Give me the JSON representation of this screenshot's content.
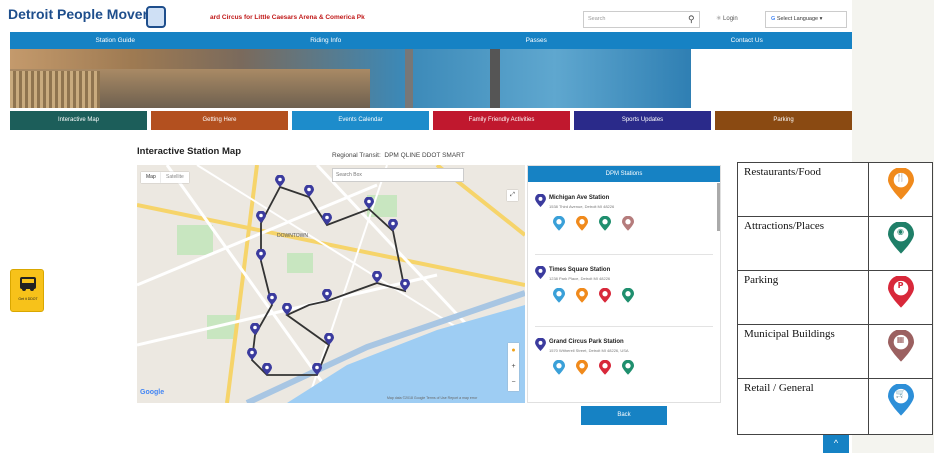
{
  "header": {
    "logo": "Detroit People Mover",
    "ticker": "ard Circus for Little Caesars Arena & Comerica Pk",
    "search_placeholder": "Search",
    "login": "Login",
    "language": "Select Language"
  },
  "nav": [
    "Station Guide",
    "Riding Info",
    "Passes",
    "Contact Us"
  ],
  "categories": [
    {
      "label": "Interactive Map",
      "color": "#1c5e5a"
    },
    {
      "label": "Getting Here",
      "color": "#b3501f"
    },
    {
      "label": "Events Calendar",
      "color": "#1d8ccb"
    },
    {
      "label": "Family Friendly Activities",
      "color": "#c0182e"
    },
    {
      "label": "Sports Updates",
      "color": "#2a2a8a"
    },
    {
      "label": "Parking",
      "color": "#8a4a12"
    }
  ],
  "section": {
    "title": "Interactive Station Map",
    "regional": "Regional Transit:",
    "transit_options": "DPM  QLINE  DDOT  SMART"
  },
  "map": {
    "view_map": "Map",
    "view_satellite": "Satellite",
    "search_placeholder": "Search Box",
    "downtown_label": "DOWNTOWN",
    "google": "Google",
    "footer": "Map data ©2018 Google   Terms of Use   Report a map error"
  },
  "panel": {
    "title": "DPM Stations",
    "stations": [
      {
        "name": "Michigan Ave Station",
        "address": "1538 Third Avenue, Detroit MI 48226",
        "icons": [
          "#3aa0d8",
          "#f08a1c",
          "#1f8f6e",
          "#b57c7c"
        ]
      },
      {
        "name": "Times Square Station",
        "address": "1238 Park Place, Detroit MI 48226",
        "icons": [
          "#3aa0d8",
          "#f08a1c",
          "#d8283a",
          "#1f8f6e"
        ]
      },
      {
        "name": "Grand Circus Park Station",
        "address": "1570 Witherell Street, Detroit MI 48226, USA",
        "icons": [
          "#3aa0d8",
          "#f08a1c",
          "#d8283a",
          "#1f8f6e"
        ]
      }
    ]
  },
  "back_button": "Back",
  "app_badge": "Get it DDOT",
  "legend": [
    {
      "label": "Restaurants/Food",
      "color": "#f08a1c",
      "icon": "food-icon",
      "glyph": "🍴"
    },
    {
      "label": "Attractions/Places",
      "color": "#1f7f68",
      "icon": "attraction-icon",
      "glyph": "◉"
    },
    {
      "label": "Parking",
      "color": "#d8283a",
      "icon": "parking-icon",
      "glyph": "P"
    },
    {
      "label": "Municipal Buildings",
      "color": "#9b6060",
      "icon": "building-icon",
      "glyph": "▦"
    },
    {
      "label": "Retail / General",
      "color": "#2d8fd8",
      "icon": "cart-icon",
      "glyph": "🛒"
    }
  ],
  "scroll_top": "^"
}
